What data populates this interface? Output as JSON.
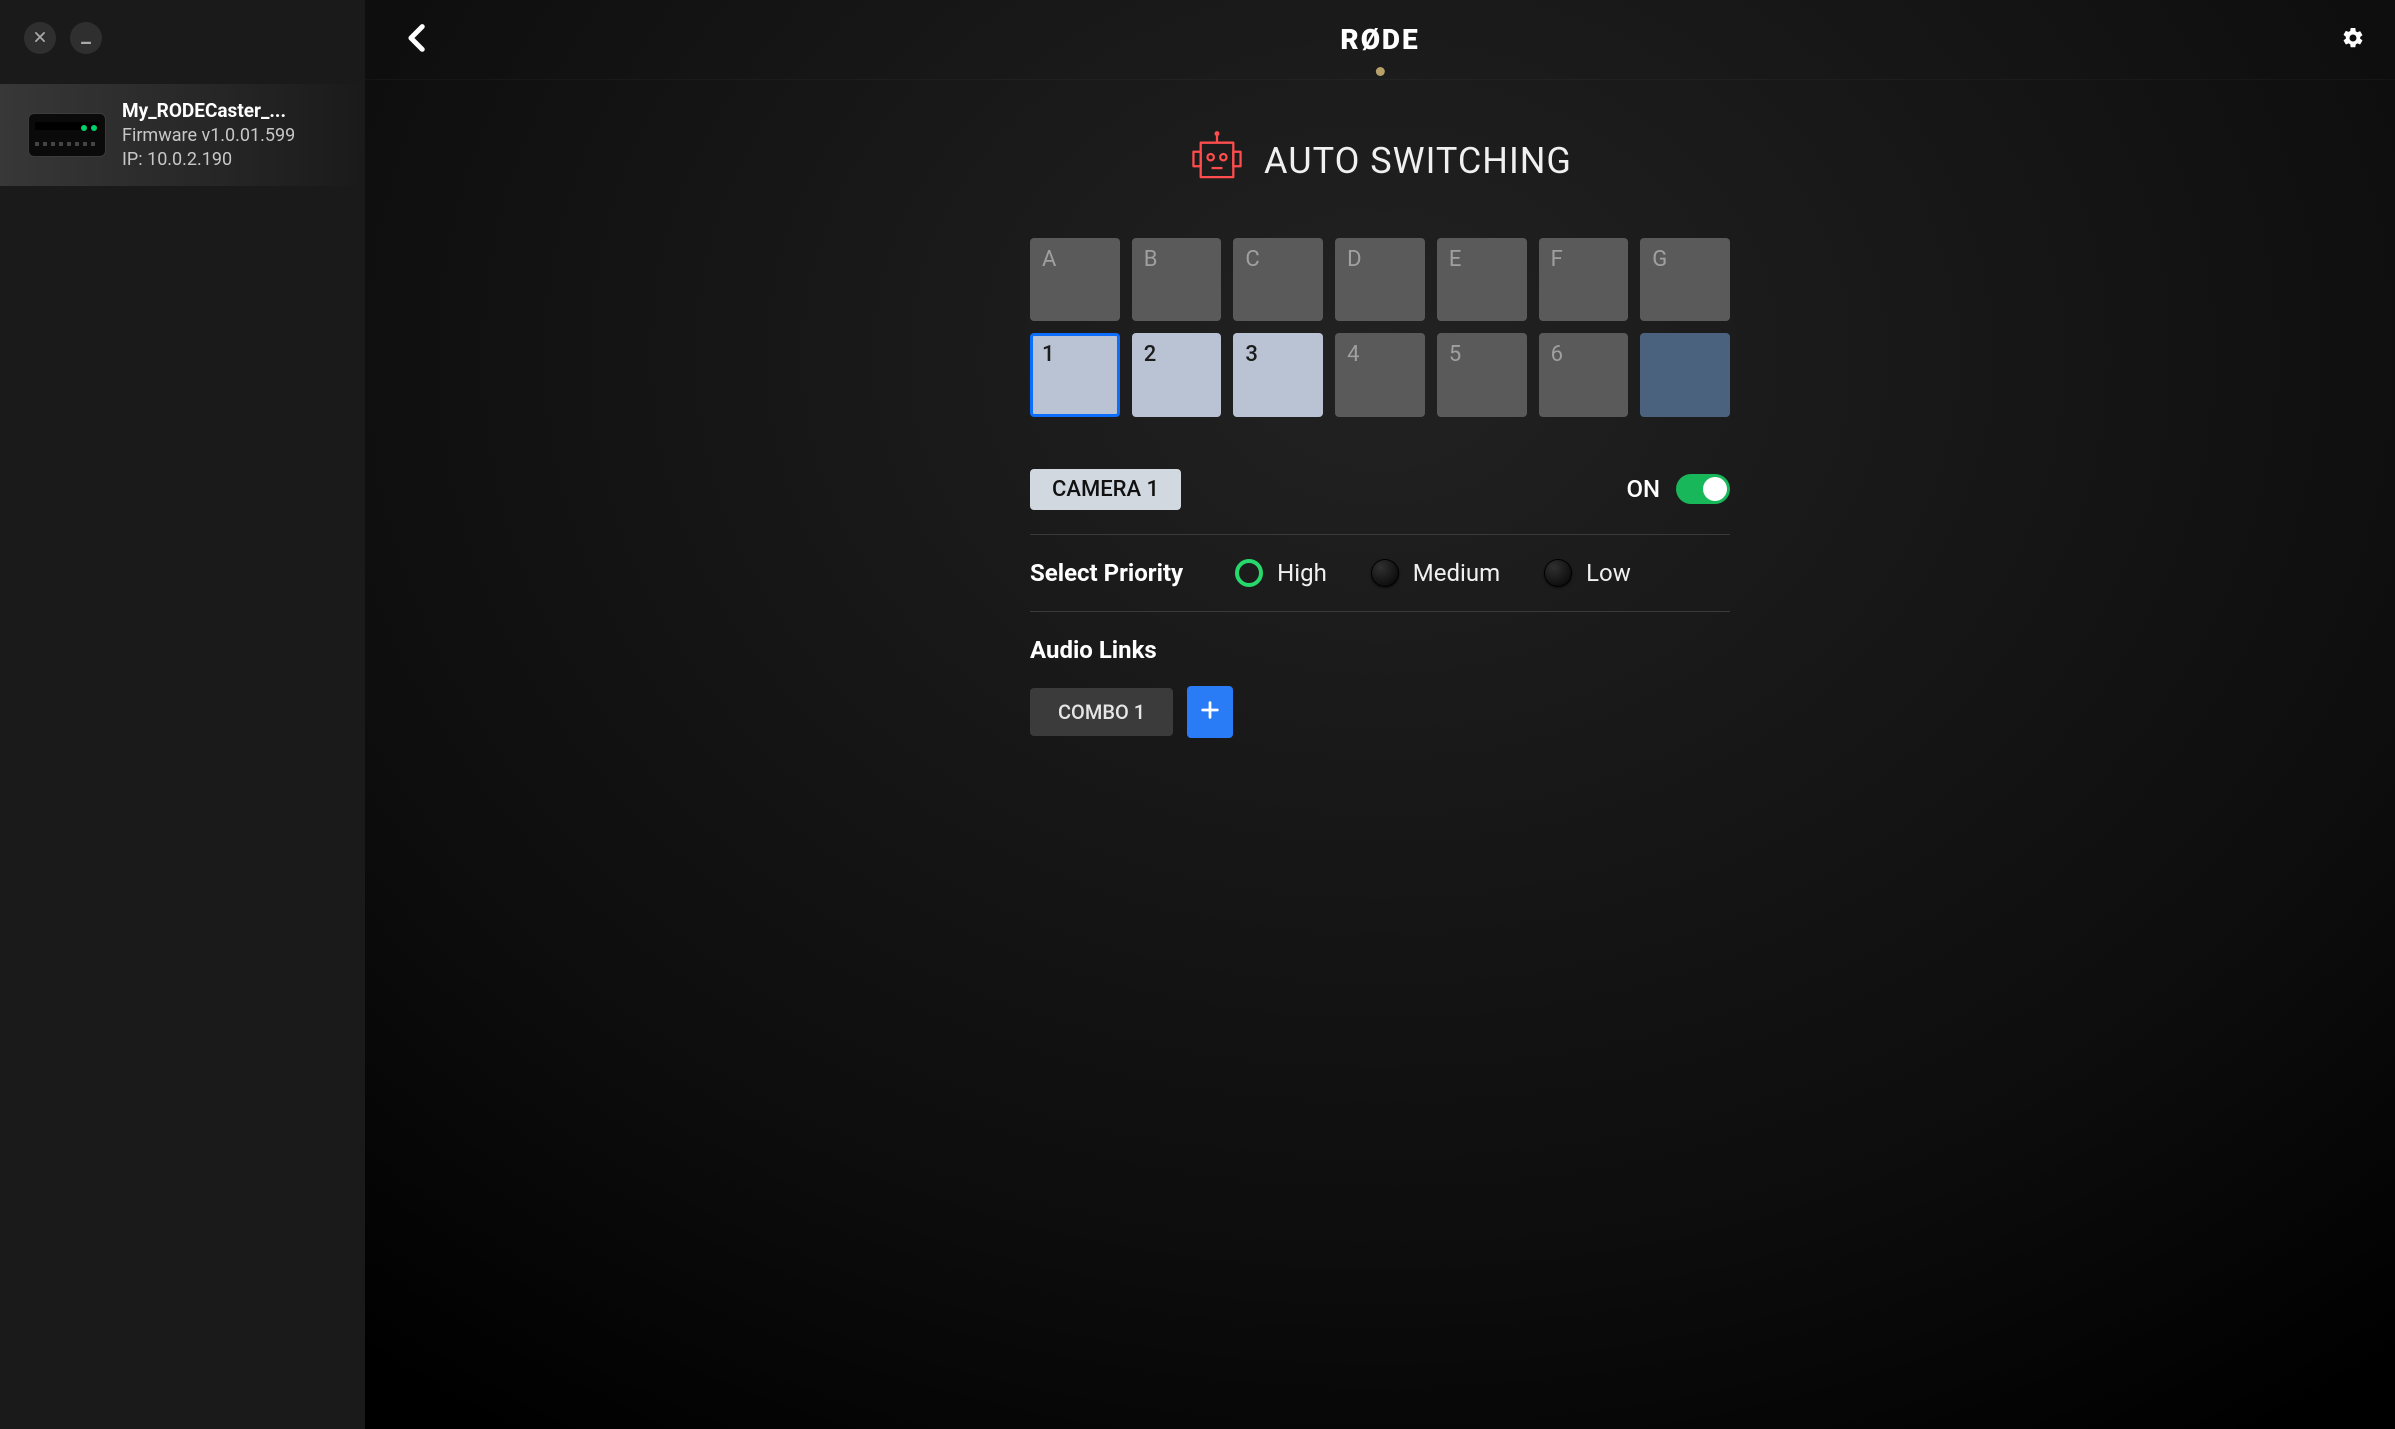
{
  "brand": "RØDE",
  "sidebar": {
    "device": {
      "name": "My_RODECaster_...",
      "firmware": "Firmware v1.0.01.599",
      "ip": "IP: 10.0.2.190"
    }
  },
  "header": {
    "title": "AUTO SWITCHING",
    "icon": "robot"
  },
  "grid": {
    "row_top": [
      {
        "label": "A",
        "style": "dark"
      },
      {
        "label": "B",
        "style": "dark"
      },
      {
        "label": "C",
        "style": "dark"
      },
      {
        "label": "D",
        "style": "dark"
      },
      {
        "label": "E",
        "style": "dark"
      },
      {
        "label": "F",
        "style": "dark"
      },
      {
        "label": "G",
        "style": "dark"
      }
    ],
    "row_bottom": [
      {
        "label": "1",
        "style": "light",
        "selected": true
      },
      {
        "label": "2",
        "style": "light"
      },
      {
        "label": "3",
        "style": "light"
      },
      {
        "label": "4",
        "style": "dark"
      },
      {
        "label": "5",
        "style": "dark"
      },
      {
        "label": "6",
        "style": "dark"
      },
      {
        "label": "",
        "style": "blueish"
      }
    ]
  },
  "camera": {
    "label": "CAMERA 1",
    "state_label": "ON",
    "on": true
  },
  "priority": {
    "label": "Select Priority",
    "options": [
      {
        "label": "High",
        "selected": true
      },
      {
        "label": "Medium",
        "selected": false
      },
      {
        "label": "Low",
        "selected": false
      }
    ]
  },
  "audio_links": {
    "label": "Audio Links",
    "items": [
      {
        "label": "COMBO 1"
      }
    ]
  }
}
